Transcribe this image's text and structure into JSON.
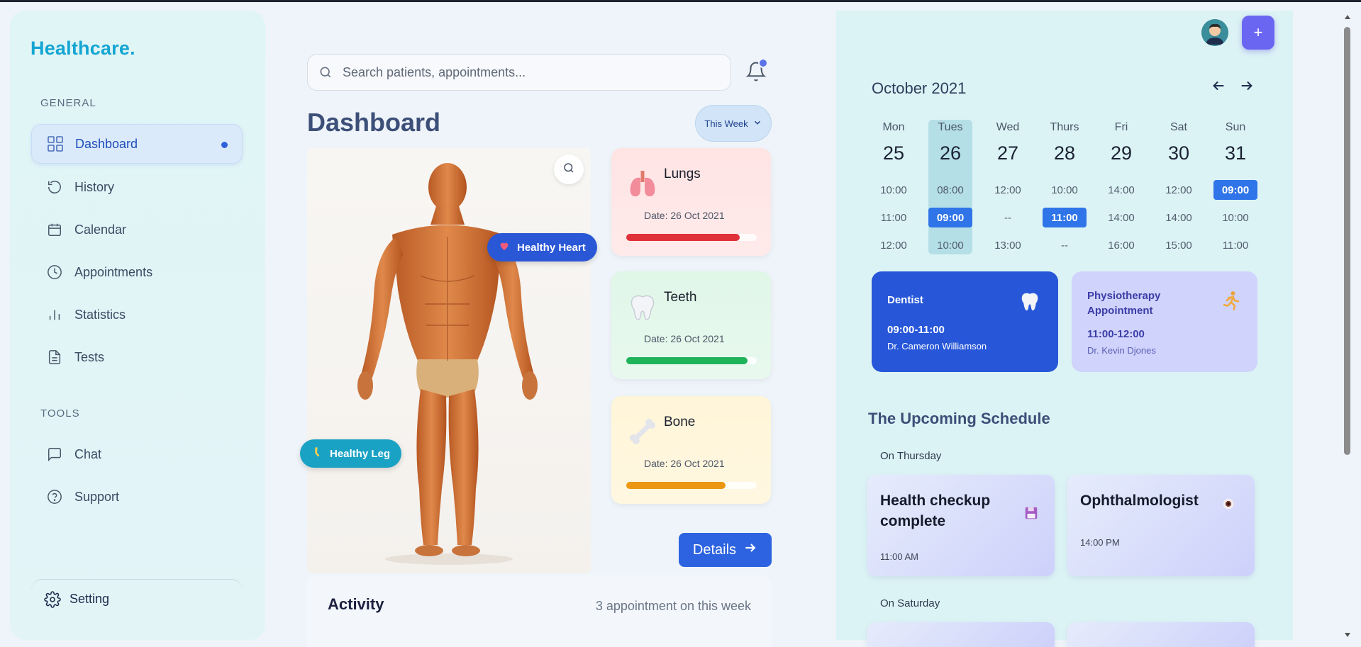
{
  "app": {
    "logo": "Healthcare."
  },
  "sidebar": {
    "general_label": "GENERAL",
    "tools_label": "TOOLS",
    "items": [
      {
        "label": "Dashboard",
        "icon": "grid-icon",
        "active": true
      },
      {
        "label": "History",
        "icon": "history-icon"
      },
      {
        "label": "Calendar",
        "icon": "calendar-icon"
      },
      {
        "label": "Appointments",
        "icon": "clock-icon"
      },
      {
        "label": "Statistics",
        "icon": "bar-chart-icon"
      },
      {
        "label": "Tests",
        "icon": "document-icon"
      }
    ],
    "tools": [
      {
        "label": "Chat",
        "icon": "chat-icon"
      },
      {
        "label": "Support",
        "icon": "help-icon"
      }
    ],
    "setting_label": "Setting"
  },
  "search": {
    "placeholder": "Search patients, appointments..."
  },
  "main": {
    "title": "Dashboard",
    "period": "This Week",
    "tags": {
      "heart": "Healthy Heart",
      "leg": "Healthy Leg"
    },
    "organs": [
      {
        "name": "Lungs",
        "date": "Date: 26 Oct 2021",
        "progress": 0.87,
        "color": "#e0313a"
      },
      {
        "name": "Teeth",
        "date": "Date: 26 Oct 2021",
        "progress": 0.93,
        "color": "#1fb35a"
      },
      {
        "name": "Bone",
        "date": "Date: 26 Oct 2021",
        "progress": 0.76,
        "color": "#ec9712"
      }
    ],
    "details_label": "Details",
    "activity": {
      "title": "Activity",
      "summary": "3 appointment on this week"
    }
  },
  "calendar": {
    "month": "October 2021",
    "days": [
      {
        "name": "Mon",
        "date": "25",
        "slots": [
          "10:00",
          "11:00",
          "12:00"
        ],
        "selected": -1
      },
      {
        "name": "Tues",
        "date": "26",
        "slots": [
          "08:00",
          "09:00",
          "10:00"
        ],
        "selected": 1
      },
      {
        "name": "Wed",
        "date": "27",
        "slots": [
          "12:00",
          "--",
          "13:00"
        ],
        "selected": -1
      },
      {
        "name": "Thurs",
        "date": "28",
        "slots": [
          "10:00",
          "11:00",
          "--"
        ],
        "selected": 1
      },
      {
        "name": "Fri",
        "date": "29",
        "slots": [
          "14:00",
          "14:00",
          "16:00"
        ],
        "selected": -1
      },
      {
        "name": "Sat",
        "date": "30",
        "slots": [
          "12:00",
          "14:00",
          "15:00"
        ],
        "selected": -1
      },
      {
        "name": "Sun",
        "date": "31",
        "slots": [
          "09:00",
          "10:00",
          "11:00"
        ],
        "selected": 0
      }
    ]
  },
  "appointments": [
    {
      "title": "Dentist",
      "time": "09:00-11:00",
      "doctor": "Dr. Cameron Williamson",
      "icon": "tooth-icon"
    },
    {
      "title": "Physiotherapy Appointment",
      "time": "11:00-12:00",
      "doctor": "Dr. Kevin Djones",
      "icon": "running-icon"
    }
  ],
  "upcoming": {
    "title": "The Upcoming Schedule",
    "groups": [
      {
        "day": "On Thursday",
        "items": [
          {
            "title": "Health checkup complete",
            "time": "11:00 AM",
            "icon": "floppy-icon"
          },
          {
            "title": "Ophthalmologist",
            "time": "14:00 PM",
            "icon": "eye-icon"
          }
        ]
      },
      {
        "day": "On Saturday",
        "items": []
      }
    ]
  }
}
